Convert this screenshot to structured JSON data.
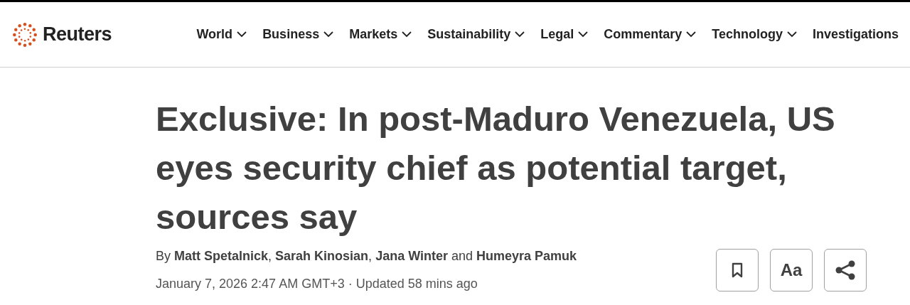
{
  "header": {
    "logo": "Reuters",
    "nav": [
      {
        "label": "World",
        "has_dropdown": true
      },
      {
        "label": "Business",
        "has_dropdown": true
      },
      {
        "label": "Markets",
        "has_dropdown": true
      },
      {
        "label": "Sustainability",
        "has_dropdown": true
      },
      {
        "label": "Legal",
        "has_dropdown": true
      },
      {
        "label": "Commentary",
        "has_dropdown": true
      },
      {
        "label": "Technology",
        "has_dropdown": true
      },
      {
        "label": "Investigations",
        "has_dropdown": false
      }
    ]
  },
  "article": {
    "headline": "Exclusive: In post-Maduro Venezuela, US eyes security chief as potential target, sources say",
    "byline": "By **Matt Spetalnick**, **Sarah Kinosian**, **Jana Winter** and **Humeyra Pamuk**",
    "dateline": "January 7, 2026 2:47 AM GMT+3 · Updated 58 mins ago",
    "tools": [
      {
        "kind": "bookmark"
      },
      {
        "kind": "text",
        "label": "Aa"
      },
      {
        "kind": "share"
      }
    ]
  }
}
